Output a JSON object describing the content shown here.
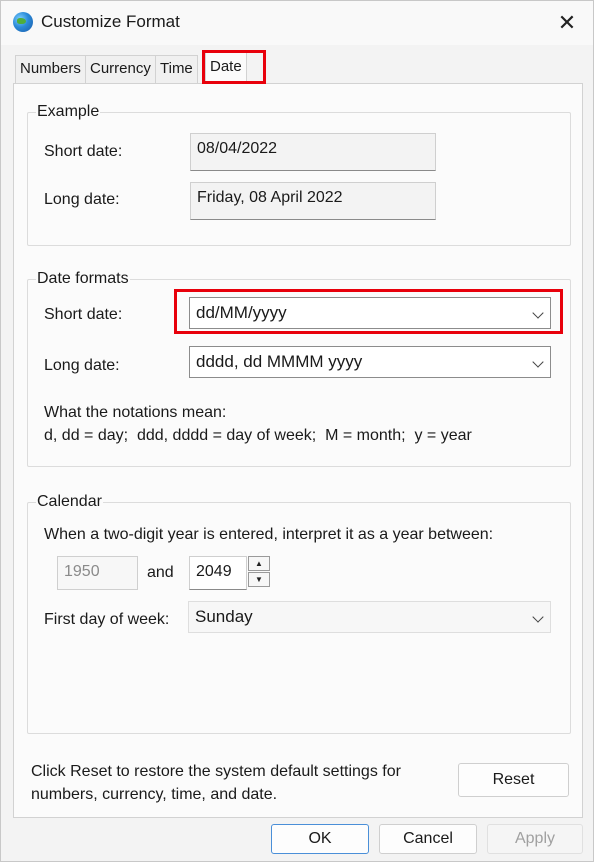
{
  "window": {
    "title": "Customize Format"
  },
  "tabs": [
    {
      "label": "Numbers"
    },
    {
      "label": "Currency"
    },
    {
      "label": "Time"
    },
    {
      "label": "Date"
    }
  ],
  "example": {
    "title": "Example",
    "short_label": "Short date:",
    "short_value": "08/04/2022",
    "long_label": "Long date:",
    "long_value": "Friday, 08 April 2022"
  },
  "formats": {
    "title": "Date formats",
    "short_label": "Short date:",
    "short_value": "dd/MM/yyyy",
    "long_label": "Long date:",
    "long_value": "dddd, dd MMMM yyyy",
    "notation_title": "What the notations mean:",
    "notation_text": "d, dd = day;  ddd, dddd = day of week;  M = month;  y = year"
  },
  "calendar": {
    "title": "Calendar",
    "two_digit_text": "When a two-digit year is entered, interpret it as a year between:",
    "year_from": "1950",
    "and_label": "and",
    "year_to": "2049",
    "first_day_label": "First day of week:",
    "first_day_value": "Sunday"
  },
  "reset": {
    "text_line1": "Click Reset to restore the system default settings for",
    "text_line2": "numbers, currency, time, and date.",
    "button_label": "Reset"
  },
  "footer": {
    "ok_label": "OK",
    "cancel_label": "Cancel",
    "apply_label": "Apply"
  },
  "colors": {
    "highlight": "#e8000b",
    "accent": "#4a8fd8"
  }
}
